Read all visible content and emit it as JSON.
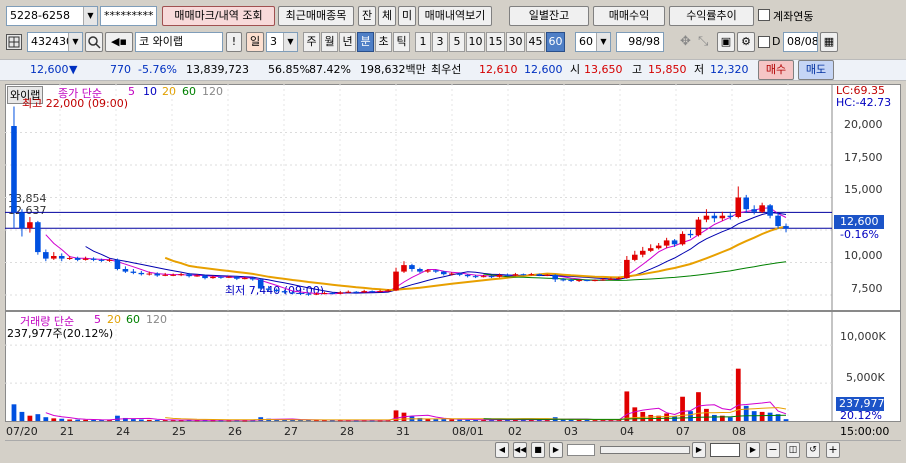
{
  "account": {
    "number": "5228-6258",
    "password": "*********"
  },
  "top_buttons": {
    "mark": "매매마크/내역 조회",
    "recent": "최근매매종목",
    "balance": "잔",
    "fill": "체",
    "unfilled": "미",
    "history": "매매내역보기",
    "daily": "일별잔고",
    "profit": "매매수익",
    "rate": "수익률추이",
    "link": "계좌연동"
  },
  "toolbar": {
    "code": "432430",
    "market": "코",
    "name": "와이랩",
    "period_type": "일",
    "period_value": "3",
    "tabs": [
      "주",
      "월",
      "년",
      "분",
      "초",
      "틱"
    ],
    "active_tab": "분",
    "minutes": [
      "1",
      "3",
      "5",
      "10",
      "15",
      "30",
      "45",
      "60"
    ],
    "active_minute": "60",
    "interval_select": "60",
    "page": "98/98",
    "d_label": "D",
    "date": "08/08"
  },
  "quote": {
    "price": "12,600",
    "arrow": "▼",
    "change": "770",
    "change_pct": "-5.76%",
    "volume": "13,839,723",
    "ratio1": "56.85%",
    "ratio2": "87.42%",
    "amount": "198,632백만",
    "best_label": "최우선",
    "bid": "12,610",
    "ask": "12,600",
    "open_label": "시",
    "open": "13,650",
    "high_label": "고",
    "high": "15,850",
    "low_label": "저",
    "low": "12,320",
    "buy": "매수",
    "sell": "매도"
  },
  "price_panel": {
    "stock_name": "와이랩",
    "legend": "종가 단순",
    "ma_periods": [
      "5",
      "10",
      "20",
      "60",
      "120"
    ],
    "high_note": "최고 22,000 (09:00)",
    "low_note": "최저 7,440 (09:00)",
    "level1": "13,854",
    "level2": "12,637",
    "lc": "LC:69.35",
    "hc": "HC:-42.73",
    "current_tag": "12,600",
    "current_pct": "-0.16%",
    "y_ticks": [
      "20,000",
      "17,500",
      "15,000",
      "12,500",
      "10,000",
      "7,500"
    ]
  },
  "volume_panel": {
    "legend": "거래량 단순",
    "ma_periods": [
      "5",
      "20",
      "60",
      "120"
    ],
    "info": "237,977주(20.12%)",
    "y_ticks": [
      "10,000K",
      "5,000K"
    ],
    "current_tag": "237,977",
    "current_pct": "20.12%"
  },
  "x_axis": {
    "labels": [
      "07/20",
      "21",
      "24",
      "25",
      "26",
      "27",
      "28",
      "31",
      "08/01",
      "02",
      "03",
      "04",
      "07",
      "08"
    ],
    "time": "15:00:00"
  },
  "chart_data": {
    "type": "candlestick",
    "interval": "60분",
    "y_range": [
      6500,
      22500
    ],
    "volume_range_k": [
      0,
      12000
    ],
    "candles": [
      {
        "o": 20500,
        "c": 13854,
        "h": 22000,
        "l": 12600,
        "v": 2200
      },
      {
        "o": 13854,
        "c": 12637,
        "h": 14100,
        "l": 12000,
        "v": 1200
      },
      {
        "o": 12637,
        "c": 13100,
        "h": 13500,
        "l": 12300,
        "v": 700
      },
      {
        "o": 13100,
        "c": 10800,
        "h": 13200,
        "l": 10600,
        "v": 900
      },
      {
        "o": 10800,
        "c": 10300,
        "h": 11000,
        "l": 10100,
        "v": 500
      },
      {
        "o": 10300,
        "c": 10500,
        "h": 10800,
        "l": 10200,
        "v": 350
      },
      {
        "o": 10500,
        "c": 10300,
        "h": 10700,
        "l": 10100,
        "v": 300
      },
      {
        "o": 10300,
        "c": 10350,
        "h": 10500,
        "l": 10200,
        "v": 200
      },
      {
        "o": 10350,
        "c": 10200,
        "h": 10450,
        "l": 10100,
        "v": 180
      },
      {
        "o": 10200,
        "c": 10300,
        "h": 10450,
        "l": 10150,
        "v": 160
      },
      {
        "o": 10300,
        "c": 10200,
        "h": 10400,
        "l": 10100,
        "v": 150
      },
      {
        "o": 10200,
        "c": 10150,
        "h": 10300,
        "l": 10050,
        "v": 130
      },
      {
        "o": 10150,
        "c": 10200,
        "h": 10300,
        "l": 10050,
        "v": 120
      },
      {
        "o": 10200,
        "c": 9500,
        "h": 10300,
        "l": 9400,
        "v": 700
      },
      {
        "o": 9500,
        "c": 9300,
        "h": 9700,
        "l": 9200,
        "v": 400
      },
      {
        "o": 9300,
        "c": 9200,
        "h": 9500,
        "l": 9100,
        "v": 250
      },
      {
        "o": 9200,
        "c": 9100,
        "h": 9350,
        "l": 9000,
        "v": 200
      },
      {
        "o": 9100,
        "c": 9150,
        "h": 9300,
        "l": 9000,
        "v": 150
      },
      {
        "o": 9150,
        "c": 9000,
        "h": 9250,
        "l": 8900,
        "v": 140
      },
      {
        "o": 9000,
        "c": 9050,
        "h": 9200,
        "l": 8950,
        "v": 120
      },
      {
        "o": 9050,
        "c": 9050,
        "h": 9150,
        "l": 8950,
        "v": 110
      },
      {
        "o": 9050,
        "c": 9100,
        "h": 9200,
        "l": 8950,
        "v": 100
      },
      {
        "o": 9100,
        "c": 8950,
        "h": 9200,
        "l": 8850,
        "v": 130
      },
      {
        "o": 8950,
        "c": 9000,
        "h": 9100,
        "l": 8900,
        "v": 100
      },
      {
        "o": 9000,
        "c": 8800,
        "h": 9050,
        "l": 8700,
        "v": 110
      },
      {
        "o": 8800,
        "c": 8900,
        "h": 9000,
        "l": 8750,
        "v": 100
      },
      {
        "o": 8900,
        "c": 8850,
        "h": 8950,
        "l": 8750,
        "v": 90
      },
      {
        "o": 8850,
        "c": 8900,
        "h": 9000,
        "l": 8800,
        "v": 90
      },
      {
        "o": 8900,
        "c": 8750,
        "h": 8950,
        "l": 8650,
        "v": 100
      },
      {
        "o": 8750,
        "c": 8800,
        "h": 8900,
        "l": 8700,
        "v": 80
      },
      {
        "o": 8800,
        "c": 8700,
        "h": 8850,
        "l": 8600,
        "v": 90
      },
      {
        "o": 8700,
        "c": 8000,
        "h": 8750,
        "l": 7900,
        "v": 500
      },
      {
        "o": 8000,
        "c": 7900,
        "h": 8200,
        "l": 7800,
        "v": 300
      },
      {
        "o": 7900,
        "c": 7800,
        "h": 8000,
        "l": 7700,
        "v": 200
      },
      {
        "o": 7800,
        "c": 7700,
        "h": 7900,
        "l": 7600,
        "v": 180
      },
      {
        "o": 7700,
        "c": 7650,
        "h": 7800,
        "l": 7550,
        "v": 150
      },
      {
        "o": 7650,
        "c": 7600,
        "h": 7700,
        "l": 7500,
        "v": 140
      },
      {
        "o": 7600,
        "c": 7550,
        "h": 7700,
        "l": 7440,
        "v": 160
      },
      {
        "o": 7550,
        "c": 7600,
        "h": 7700,
        "l": 7500,
        "v": 120
      },
      {
        "o": 7600,
        "c": 7650,
        "h": 7750,
        "l": 7550,
        "v": 110
      },
      {
        "o": 7650,
        "c": 7600,
        "h": 7700,
        "l": 7550,
        "v": 100
      },
      {
        "o": 7600,
        "c": 7700,
        "h": 7800,
        "l": 7550,
        "v": 110
      },
      {
        "o": 7700,
        "c": 7750,
        "h": 7850,
        "l": 7650,
        "v": 100
      },
      {
        "o": 7750,
        "c": 7700,
        "h": 7800,
        "l": 7650,
        "v": 90
      },
      {
        "o": 7700,
        "c": 7800,
        "h": 7900,
        "l": 7650,
        "v": 100
      },
      {
        "o": 7800,
        "c": 7750,
        "h": 7850,
        "l": 7700,
        "v": 90
      },
      {
        "o": 7750,
        "c": 7800,
        "h": 7900,
        "l": 7700,
        "v": 80
      },
      {
        "o": 7800,
        "c": 7850,
        "h": 7950,
        "l": 7750,
        "v": 90
      },
      {
        "o": 7850,
        "c": 9300,
        "h": 9600,
        "l": 7800,
        "v": 1400
      },
      {
        "o": 9300,
        "c": 9800,
        "h": 10100,
        "l": 9200,
        "v": 1100
      },
      {
        "o": 9800,
        "c": 9500,
        "h": 9900,
        "l": 9300,
        "v": 600
      },
      {
        "o": 9500,
        "c": 9300,
        "h": 9600,
        "l": 9200,
        "v": 400
      },
      {
        "o": 9300,
        "c": 9400,
        "h": 9500,
        "l": 9200,
        "v": 300
      },
      {
        "o": 9400,
        "c": 9300,
        "h": 9450,
        "l": 9200,
        "v": 250
      },
      {
        "o": 9300,
        "c": 9100,
        "h": 9350,
        "l": 9000,
        "v": 250
      },
      {
        "o": 9100,
        "c": 9150,
        "h": 9250,
        "l": 9000,
        "v": 200
      },
      {
        "o": 9150,
        "c": 9050,
        "h": 9200,
        "l": 8950,
        "v": 180
      },
      {
        "o": 9050,
        "c": 8950,
        "h": 9100,
        "l": 8850,
        "v": 170
      },
      {
        "o": 8950,
        "c": 8900,
        "h": 9050,
        "l": 8800,
        "v": 150
      },
      {
        "o": 8900,
        "c": 8950,
        "h": 9050,
        "l": 8850,
        "v": 130
      },
      {
        "o": 8950,
        "c": 8900,
        "h": 9000,
        "l": 8800,
        "v": 120
      },
      {
        "o": 8900,
        "c": 9050,
        "h": 9150,
        "l": 8850,
        "v": 200
      },
      {
        "o": 9050,
        "c": 9000,
        "h": 9150,
        "l": 8950,
        "v": 180
      },
      {
        "o": 9000,
        "c": 9100,
        "h": 9200,
        "l": 8950,
        "v": 200
      },
      {
        "o": 9100,
        "c": 9050,
        "h": 9150,
        "l": 9000,
        "v": 170
      },
      {
        "o": 9050,
        "c": 9100,
        "h": 9200,
        "l": 9000,
        "v": 150
      },
      {
        "o": 9100,
        "c": 9000,
        "h": 9150,
        "l": 8950,
        "v": 150
      },
      {
        "o": 9000,
        "c": 9050,
        "h": 9100,
        "l": 8950,
        "v": 120
      },
      {
        "o": 9050,
        "c": 8700,
        "h": 9100,
        "l": 8500,
        "v": 500
      },
      {
        "o": 8700,
        "c": 8650,
        "h": 8800,
        "l": 8550,
        "v": 250
      },
      {
        "o": 8650,
        "c": 8600,
        "h": 8750,
        "l": 8500,
        "v": 200
      },
      {
        "o": 8600,
        "c": 8650,
        "h": 8700,
        "l": 8500,
        "v": 180
      },
      {
        "o": 8650,
        "c": 8600,
        "h": 8700,
        "l": 8550,
        "v": 150
      },
      {
        "o": 8600,
        "c": 8650,
        "h": 8700,
        "l": 8550,
        "v": 120
      },
      {
        "o": 8650,
        "c": 8700,
        "h": 8800,
        "l": 8600,
        "v": 130
      },
      {
        "o": 8700,
        "c": 8750,
        "h": 8850,
        "l": 8650,
        "v": 120
      },
      {
        "o": 8750,
        "c": 8800,
        "h": 8900,
        "l": 8700,
        "v": 140
      },
      {
        "o": 8800,
        "c": 10200,
        "h": 10500,
        "l": 8750,
        "v": 3900
      },
      {
        "o": 10200,
        "c": 10600,
        "h": 10900,
        "l": 10100,
        "v": 1800
      },
      {
        "o": 10600,
        "c": 10900,
        "h": 11200,
        "l": 10400,
        "v": 1200
      },
      {
        "o": 10900,
        "c": 11100,
        "h": 11400,
        "l": 10800,
        "v": 800
      },
      {
        "o": 11100,
        "c": 11300,
        "h": 11500,
        "l": 11000,
        "v": 700
      },
      {
        "o": 11300,
        "c": 11700,
        "h": 11900,
        "l": 11100,
        "v": 1000
      },
      {
        "o": 11700,
        "c": 11400,
        "h": 11800,
        "l": 11200,
        "v": 600
      },
      {
        "o": 11400,
        "c": 12200,
        "h": 12400,
        "l": 11300,
        "v": 3200
      },
      {
        "o": 12200,
        "c": 12100,
        "h": 12500,
        "l": 11900,
        "v": 1300
      },
      {
        "o": 12100,
        "c": 13300,
        "h": 13500,
        "l": 12000,
        "v": 3800
      },
      {
        "o": 13300,
        "c": 13600,
        "h": 14100,
        "l": 13100,
        "v": 1600
      },
      {
        "o": 13600,
        "c": 13400,
        "h": 13800,
        "l": 13100,
        "v": 800
      },
      {
        "o": 13400,
        "c": 13600,
        "h": 13900,
        "l": 13200,
        "v": 700
      },
      {
        "o": 13600,
        "c": 13500,
        "h": 13900,
        "l": 13300,
        "v": 500
      },
      {
        "o": 13500,
        "c": 15000,
        "h": 15850,
        "l": 13400,
        "v": 6900
      },
      {
        "o": 15000,
        "c": 14100,
        "h": 15200,
        "l": 13800,
        "v": 2000
      },
      {
        "o": 14100,
        "c": 13900,
        "h": 14400,
        "l": 13700,
        "v": 1300
      },
      {
        "o": 13900,
        "c": 14400,
        "h": 14600,
        "l": 13800,
        "v": 1200
      },
      {
        "o": 14400,
        "c": 13600,
        "h": 14500,
        "l": 13400,
        "v": 1100
      },
      {
        "o": 13600,
        "c": 12800,
        "h": 13800,
        "l": 12600,
        "v": 900
      },
      {
        "o": 12800,
        "c": 12600,
        "h": 13000,
        "l": 12320,
        "v": 238
      }
    ]
  }
}
